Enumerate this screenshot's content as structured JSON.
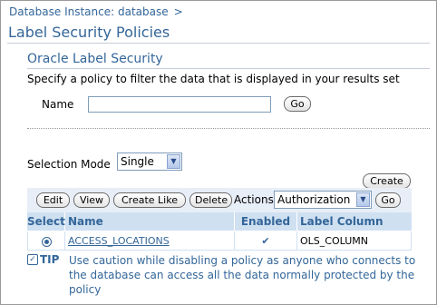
{
  "breadcrumb": {
    "label": "Database Instance: database",
    "separator": ">"
  },
  "page_title": "Label Security Policies",
  "search_section": {
    "title": "Oracle Label Security",
    "instructions": "Specify a policy to filter the data that is displayed in your results set",
    "name_label": "Name",
    "name_value": "",
    "go_label": "Go"
  },
  "selection": {
    "label": "Selection Mode",
    "value": "Single"
  },
  "create_label": "Create",
  "toolbar": {
    "edit": "Edit",
    "view": "View",
    "create_like": "Create Like",
    "delete": "Delete",
    "actions_label": "Actions",
    "actions_value": "Authorization",
    "go": "Go"
  },
  "table": {
    "headers": {
      "select": "Select",
      "name": "Name",
      "enabled": "Enabled",
      "label_column": "Label Column"
    },
    "rows": [
      {
        "selected": true,
        "name": "ACCESS_LOCATIONS",
        "enabled": "✔",
        "label_column": "OLS_COLUMN"
      }
    ]
  },
  "tip": {
    "label": "TIP",
    "text": "Use caution while disabling a policy as anyone who connects to the database can access all the data normally protected by the policy"
  },
  "colors": {
    "accent": "#336699",
    "header_bg": "#cfe0f1"
  }
}
